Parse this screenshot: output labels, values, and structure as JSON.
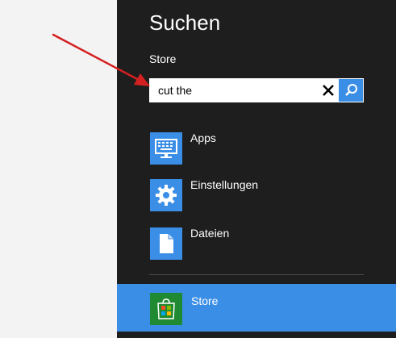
{
  "charm": {
    "title": "Suchen",
    "scope": "Store"
  },
  "search": {
    "value": "cut the",
    "clear_icon": "close-icon",
    "submit_icon": "search-icon"
  },
  "filters": [
    {
      "label": "Apps",
      "icon": "keyboard-screen-icon"
    },
    {
      "label": "Einstellungen",
      "icon": "gear-icon"
    },
    {
      "label": "Dateien",
      "icon": "document-icon"
    }
  ],
  "selected_app": {
    "label": "Store",
    "icon": "store-bag-icon"
  },
  "colors": {
    "accent": "#3b8ee6",
    "charm_bg": "#1e1e1e",
    "store_tile": "#1f8a32",
    "annotation_arrow": "#d42020",
    "left_bg": "#f3f3f3"
  }
}
